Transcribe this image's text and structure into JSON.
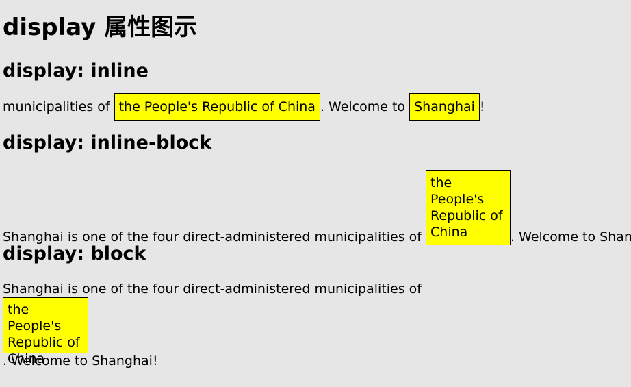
{
  "heading": {
    "main": "display 属性图示"
  },
  "inline_section": {
    "title": "display: inline",
    "text_before": "municipalities of ",
    "box1": "the People's Republic of China",
    "text_middle": ". Welcome to ",
    "box2": "Shanghai",
    "text_after": "!"
  },
  "inline_block_section": {
    "title": "display: inline-block",
    "text_before": "Shanghai is one of the four direct-administered municipalities of ",
    "box": "the People's Republic of China",
    "text_after": ". Welcome to Shanghai!"
  },
  "block_section": {
    "title": "display: block",
    "text_before": "Shanghai is one of the four direct-administered municipalities of",
    "box": "the People's Republic of China",
    "text_after": ". Welcome to Shanghai!"
  },
  "colors": {
    "background": "#e6e6e6",
    "highlight": "#ffff00",
    "border": "#000000"
  }
}
